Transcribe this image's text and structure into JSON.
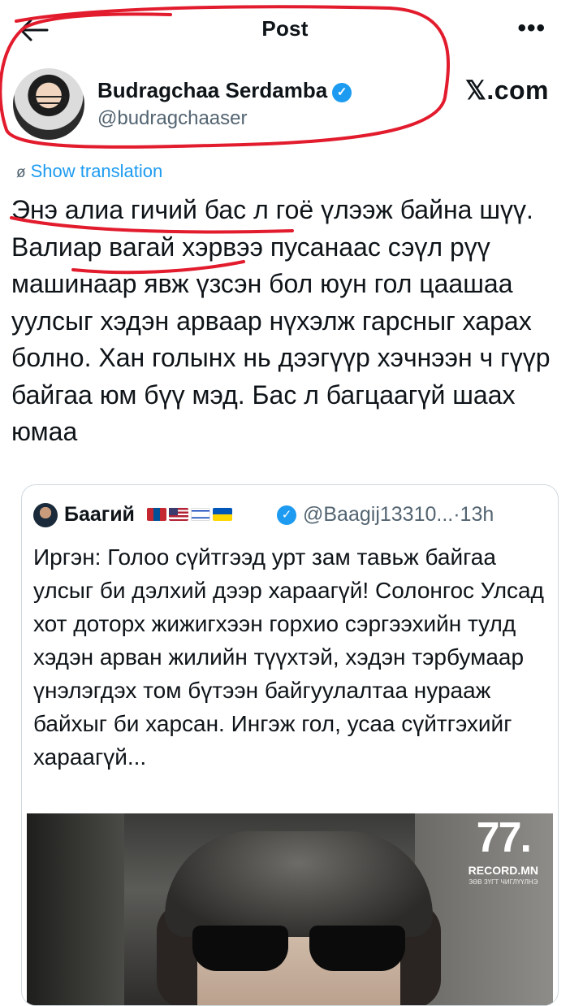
{
  "topbar": {
    "title": "Post",
    "back_icon": "arrow-left-icon",
    "more_icon": "more-horizontal-icon",
    "more_glyph": "•••"
  },
  "author": {
    "name": "Budragchaa Serdamba",
    "handle": "@budragchaaser",
    "verified_glyph": "✓"
  },
  "watermark": "𝕏.com",
  "translate": {
    "icon": "globe-icon",
    "icon_glyph": "ø",
    "label": "Show translation"
  },
  "tweet": {
    "text": "Энэ алиа гичий бас л гоё үлээж байна шүү. Валиар вагай хэрвээ пусанаас сэүл рүү машинаар явж үзсэн бол юун гол цаашаа уулсыг хэдэн арваар нүхэлж гарсныг харах болно. Хан голынх нь дээгүүр хэчнээн ч гүүр байгаа юм бүү мэд. Бас л багцаагүй шаах юмаа"
  },
  "quote": {
    "name": "Баагий",
    "flags": [
      "mongolia-flag",
      "usa-flag",
      "israel-flag",
      "ukraine-flag"
    ],
    "verified_glyph": "✓",
    "handle_time": "@Baagij13310...·13h",
    "text": "Иргэн: Голоо сүйтгээд урт зам тавьж байгаа улсыг би дэлхий дээр хараагүй! Солонгос Улсад хот доторх жижигхээн горхио сэргээхийн тулд хэдэн арван жилийн түүхтэй, хэдэн тэрбумаар үнэлэгдэх том бүтээн байгуулалтаа нурааж байхыг би харсан. Ингэж гол, усаа сүйтгэхийг хараагүй...",
    "media": {
      "logo_mark": "77.",
      "logo_name": "RECORD.MN",
      "logo_sub": "ЗӨВ ЗҮГТ ЧИГЛҮҮЛНЭ"
    }
  },
  "annotations": {
    "color": "#e21b2d"
  }
}
